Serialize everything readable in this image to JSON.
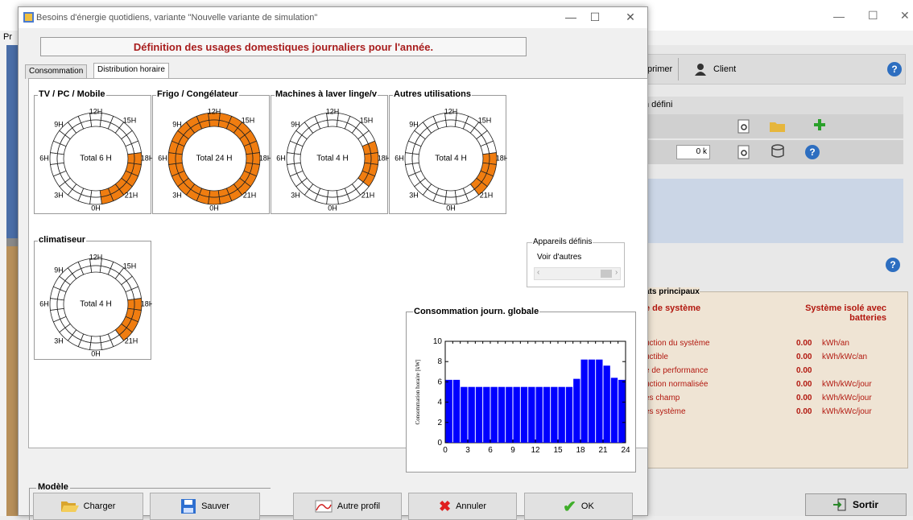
{
  "background_window": {
    "title_stub": "Pr",
    "toolbar": {
      "imprimer_label": "primer",
      "client_label": "Client"
    },
    "row1_text": "n défini",
    "row2_value": "0 k",
    "results": {
      "heading": "ats principaux",
      "col1_header": "e de système",
      "col2_header": "Système isolé avec batteries",
      "rows": [
        {
          "label": "uction du système",
          "value": "0.00",
          "unit": "kWh/an"
        },
        {
          "label": "uctible",
          "value": "0.00",
          "unit": "kWh/kWc/an"
        },
        {
          "label": "e de performance",
          "value": "0.00",
          "unit": ""
        },
        {
          "label": "uction normalisée",
          "value": "0.00",
          "unit": "kWh/kWc/jour"
        },
        {
          "label": "es champ",
          "value": "0.00",
          "unit": "kWh/kWc/jour"
        },
        {
          "label": "es système",
          "value": "0.00",
          "unit": "kWh/kWc/jour"
        }
      ]
    },
    "sortir_label": "Sortir"
  },
  "dialog": {
    "title": "Besoins d'énergie quotidiens, variante \"Nouvelle variante de simulation\"",
    "header": "Définition des usages domestiques journaliers pour l'année.",
    "tabs": [
      {
        "label": "Consommation",
        "active": false
      },
      {
        "label": "Distribution horaire",
        "active": true
      }
    ],
    "clocks": [
      {
        "title": "TV / PC / Mobile",
        "total": "Total 6 H",
        "active_hours": [
          18,
          19,
          20,
          21,
          22,
          23
        ]
      },
      {
        "title": "Frigo / Congélateur",
        "total": "Total 24 H",
        "active_hours": [
          0,
          1,
          2,
          3,
          4,
          5,
          6,
          7,
          8,
          9,
          10,
          11,
          12,
          13,
          14,
          15,
          16,
          17,
          18,
          19,
          20,
          21,
          22,
          23
        ]
      },
      {
        "title": "Machines à laver linge/v",
        "total": "Total 4 H",
        "active_hours": [
          17,
          18,
          19,
          20
        ]
      },
      {
        "title": "Autres utilisations",
        "total": "Total 4 H",
        "active_hours": [
          18,
          19,
          20,
          21
        ]
      },
      {
        "title": "climatiseur",
        "total": "Total 4 H",
        "active_hours": [
          18,
          19,
          20,
          21
        ]
      }
    ],
    "clock_labels": {
      "h12": "12H",
      "h15": "15H",
      "h18": "18H",
      "h21": "21H",
      "h0": "0H",
      "h3": "3H",
      "h6": "6H",
      "h9": "9H"
    },
    "appareils": {
      "title": "Appareils définis",
      "link": "Voir d'autres"
    },
    "chart_title": "Consommation journ. globale",
    "modele_title": "Modèle",
    "buttons": {
      "charger": "Charger",
      "sauver": "Sauver",
      "autre_profil": "Autre profil",
      "annuler": "Annuler",
      "ok": "OK"
    }
  },
  "colors": {
    "active_segment": "#f07d10",
    "bar": "#0000ff",
    "header_text": "#a81d1d"
  },
  "chart_data": {
    "type": "bar",
    "title": "Consommation journ. globale",
    "ylabel": "Consommation horaire [kW]",
    "xlabel": "",
    "x_ticks": [
      0,
      3,
      6,
      9,
      12,
      15,
      18,
      21,
      24
    ],
    "y_ticks": [
      0,
      2,
      4,
      6,
      8,
      10
    ],
    "ylim": [
      0,
      10
    ],
    "xlim": [
      0,
      24
    ],
    "categories": [
      0,
      1,
      2,
      3,
      4,
      5,
      6,
      7,
      8,
      9,
      10,
      11,
      12,
      13,
      14,
      15,
      16,
      17,
      18,
      19,
      20,
      21,
      22,
      23
    ],
    "values": [
      6.2,
      6.2,
      5.5,
      5.5,
      5.5,
      5.5,
      5.5,
      5.5,
      5.5,
      5.5,
      5.5,
      5.5,
      5.5,
      5.5,
      5.5,
      5.5,
      5.5,
      6.3,
      8.2,
      8.2,
      8.2,
      7.6,
      6.4,
      6.2
    ]
  }
}
